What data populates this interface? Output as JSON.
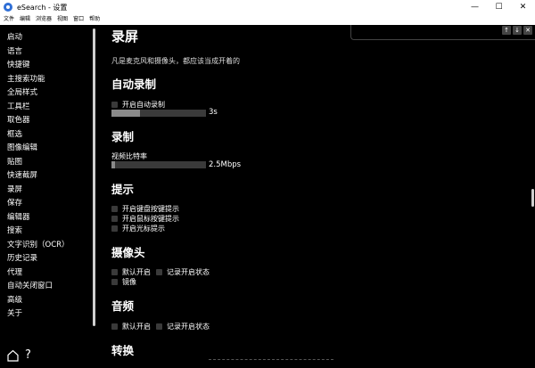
{
  "window": {
    "title": "eSearch - 设置",
    "min_glyph": "—",
    "max_glyph": "☐",
    "close_glyph": "✕"
  },
  "menu": [
    "文件",
    "编辑",
    "浏览器",
    "视图",
    "窗口",
    "帮助"
  ],
  "sidebar": {
    "items": [
      "启动",
      "语言",
      "快捷键",
      "主搜索功能",
      "全局样式",
      "工具栏",
      "取色器",
      "框选",
      "图像编辑",
      "贴图",
      "快速截屏",
      "录屏",
      "保存",
      "编辑器",
      "搜索",
      "文字识别（OCR）",
      "历史记录",
      "代理",
      "自动关闭窗口",
      "高级",
      "关于"
    ],
    "help_glyph": "?"
  },
  "search_bar": {
    "up_glyph": "↑",
    "down_glyph": "↓",
    "close_glyph": "✕"
  },
  "content": {
    "page_title": "录屏",
    "description": "凡是麦克风和摄像头，都应该当成开着的",
    "auto_record": {
      "title": "自动录制",
      "checkbox_label": "开启自动录制",
      "slider_value": "3s",
      "slider_fraction": 0.3
    },
    "record": {
      "title": "录制",
      "bitrate_label": "视频比特率",
      "slider_value": "2.5Mbps",
      "slider_fraction": 0.04
    },
    "hints": {
      "title": "提示",
      "options": [
        "开启键盘按键提示",
        "开启鼠标按键提示",
        "开启光标提示"
      ]
    },
    "camera": {
      "title": "摄像头",
      "default_on": "默认开启",
      "record_state": "记录开启状态",
      "mirror": "镜像"
    },
    "audio": {
      "title": "音频",
      "default_on": "默认开启",
      "record_state": "记录开启状态"
    },
    "convert": {
      "title": "转换"
    }
  }
}
